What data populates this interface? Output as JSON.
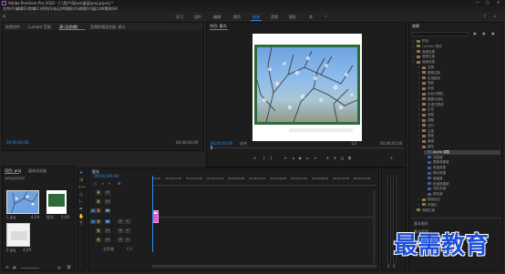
{
  "titlebar": {
    "title": "Adobe Premiere Pro 2020 - C:\\用户\\Sjbxs\\桌面\\proj.prproj *"
  },
  "menubar": [
    "文件(F)",
    "编辑(E)",
    "剪辑(C)",
    "序列(S)",
    "标记(M)",
    "图形(G)",
    "视图(V)",
    "窗口(W)",
    "帮助(H)"
  ],
  "workspaces": [
    "学习",
    "组件",
    "编辑",
    "颜色",
    "效果",
    "音频",
    "图形",
    "库"
  ],
  "source_panel": {
    "tabs": [
      "效果控件",
      "Lumetri 范围",
      "源:(无剪辑)",
      "音频剪辑混合器: 星光"
    ],
    "timecode_left": "00;00;00;00",
    "timecode_right": "00;00;00;00"
  },
  "program_panel": {
    "title": "节目: 星光",
    "timecode": "00;00;00;00",
    "fit": "适合",
    "quality": "1/2",
    "duration": "00;00;05;00"
  },
  "effects_panel": {
    "title": "效果",
    "items": [
      {
        "label": "预设",
        "depth": 0,
        "kind": "folder"
      },
      {
        "label": "Lumetri 预设",
        "depth": 0,
        "kind": "folder"
      },
      {
        "label": "音频效果",
        "depth": 0,
        "kind": "folder"
      },
      {
        "label": "音频过渡",
        "depth": 0,
        "kind": "folder"
      },
      {
        "label": "视频效果",
        "depth": 0,
        "kind": "folder"
      },
      {
        "label": "变换",
        "depth": 1,
        "kind": "folder"
      },
      {
        "label": "图像控制",
        "depth": 1,
        "kind": "folder"
      },
      {
        "label": "实用程序",
        "depth": 1,
        "kind": "folder"
      },
      {
        "label": "扭曲",
        "depth": 1,
        "kind": "folder"
      },
      {
        "label": "时间",
        "depth": 1,
        "kind": "folder"
      },
      {
        "label": "杂色与颗粒",
        "depth": 1,
        "kind": "folder"
      },
      {
        "label": "模糊与锐化",
        "depth": 1,
        "kind": "folder"
      },
      {
        "label": "沉浸式视频",
        "depth": 1,
        "kind": "folder"
      },
      {
        "label": "生成",
        "depth": 1,
        "kind": "folder"
      },
      {
        "label": "视频",
        "depth": 1,
        "kind": "folder"
      },
      {
        "label": "调整",
        "depth": 1,
        "kind": "folder"
      },
      {
        "label": "过时",
        "depth": 1,
        "kind": "folder"
      },
      {
        "label": "过渡",
        "depth": 1,
        "kind": "folder"
      },
      {
        "label": "透视",
        "depth": 1,
        "kind": "folder"
      },
      {
        "label": "通道",
        "depth": 1,
        "kind": "folder"
      },
      {
        "label": "键控",
        "depth": 1,
        "kind": "folder"
      },
      {
        "label": "Alpha 调整",
        "depth": 2,
        "kind": "fx",
        "selected": true
      },
      {
        "label": "亮度键",
        "depth": 2,
        "kind": "fx"
      },
      {
        "label": "图像遮罩键",
        "depth": 2,
        "kind": "fx"
      },
      {
        "label": "差值遮罩",
        "depth": 2,
        "kind": "fx"
      },
      {
        "label": "移除遮罩",
        "depth": 2,
        "kind": "fx"
      },
      {
        "label": "超级键",
        "depth": 2,
        "kind": "fx"
      },
      {
        "label": "轨道遮罩键",
        "depth": 2,
        "kind": "fx"
      },
      {
        "label": "非红色键",
        "depth": 2,
        "kind": "fx"
      },
      {
        "label": "颜色键",
        "depth": 2,
        "kind": "fx"
      },
      {
        "label": "颜色校正",
        "depth": 1,
        "kind": "folder"
      },
      {
        "label": "风格化",
        "depth": 1,
        "kind": "folder"
      },
      {
        "label": "视频过渡",
        "depth": 0,
        "kind": "folder"
      }
    ],
    "bottom_items": [
      "基本图形",
      "基本声音",
      "Lumetri 颜色",
      "库"
    ]
  },
  "project_panel": {
    "tabs": [
      "项目: proj",
      "媒体浏览器"
    ],
    "filename": "proj.prproj",
    "clips": [
      {
        "name": "1.jpg",
        "duration": "4;29"
      },
      {
        "name": "星光",
        "duration": "5;00"
      },
      {
        "name": "2.jpg",
        "duration": "4;29"
      }
    ]
  },
  "timeline": {
    "title": "星光",
    "timecode": "00;00;00;00",
    "ruler": [
      "00;00",
      "00;00;01;00",
      "00;00;02;00",
      "00;00;03;00",
      "00;00;04;00",
      "00;00;05;00",
      "00;00;06;00",
      "00;00;07;00",
      "00;00;08;00",
      "00;00;09;00",
      "00;00;10;00"
    ],
    "video_tracks": [
      "V3",
      "V2",
      "V1"
    ],
    "audio_tracks": [
      "A1",
      "A2",
      "A3"
    ],
    "master_label": "主声道",
    "master_value": "0.0"
  },
  "watermark": "最需教育",
  "colors": {
    "accent": "#2d8ceb",
    "clip": "#e05ac8",
    "frame_green": "#2f6b3a",
    "workspace_active": "#2d8ceb"
  }
}
